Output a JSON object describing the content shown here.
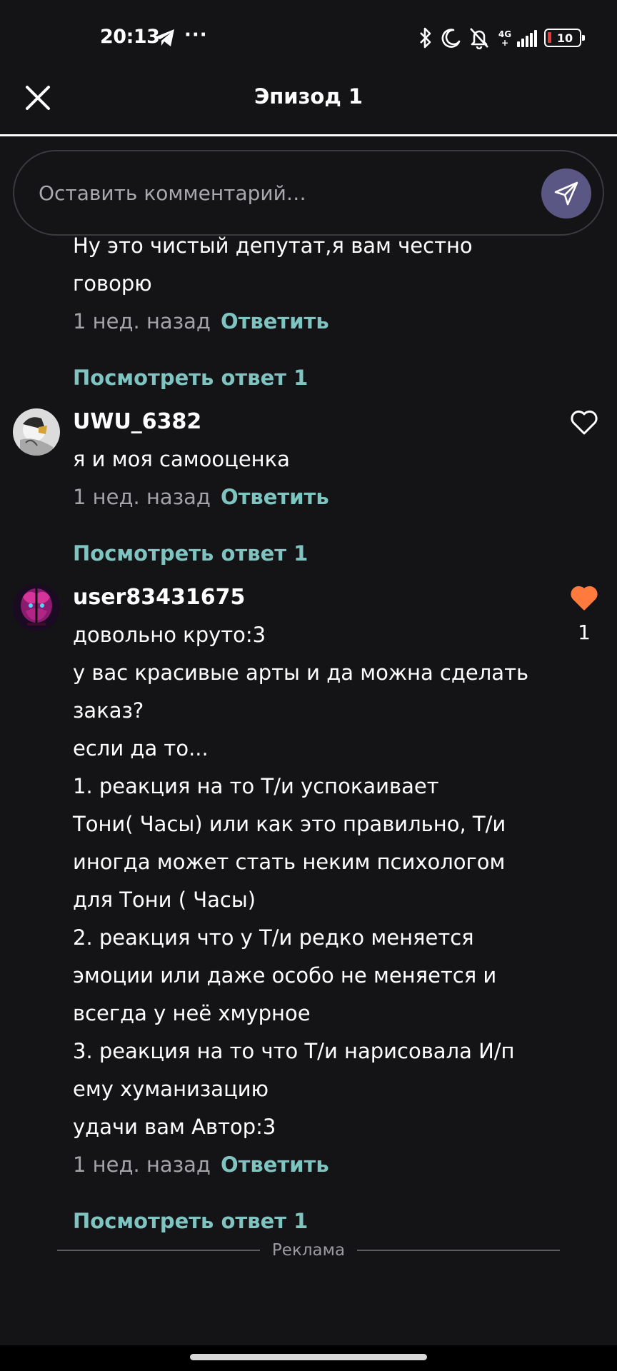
{
  "status_bar": {
    "time": "20:13",
    "dots": "···",
    "network": "4G+",
    "battery": "10"
  },
  "header": {
    "title": "Эпизод 1"
  },
  "comment_box": {
    "placeholder": "Оставить комментарий…"
  },
  "comments": [
    {
      "lines": [
        "Ну это чистый депутат,я вам честно",
        "говорю"
      ],
      "time": "1 нед. назад",
      "reply_label": "Ответить",
      "view_replies": "Посмотреть ответ 1"
    },
    {
      "username": "UWU_6382",
      "lines": [
        "я и моя самооценка"
      ],
      "time": "1 нед. назад",
      "reply_label": "Ответить",
      "view_replies": "Посмотреть ответ 1",
      "liked": false
    },
    {
      "username": "user83431675",
      "lines": [
        "довольно круто:3",
        "у вас красивые арты и да можна сделать",
        "заказ?",
        "если да то...",
        "1. реакция на то Т/и успокаивает",
        "Тони( Часы) или как это правильно, Т/и",
        "иногда может стать неким психологом",
        "для Тони ( Часы)",
        "2. реакция что у Т/и редко меняется",
        "эмоции или даже особо не меняется и",
        "всегда у неё хмурное",
        "3. реакция на то что Т/и нарисовала И/п",
        "ему хуманизацию",
        "удачи вам Автор:3"
      ],
      "time": "1 нед. назад",
      "reply_label": "Ответить",
      "view_replies": "Посмотреть ответ 1",
      "liked": true,
      "like_count": "1"
    }
  ],
  "ad": {
    "label": "Реклама"
  },
  "colors": {
    "background": "#141316",
    "accent_teal": "#7fc4c0",
    "like_active": "#ff7a3c",
    "send_button": "#5b5785"
  },
  "icons": {
    "close": "close-icon",
    "send": "send-icon",
    "heart_outline": "heart-outline-icon",
    "heart_filled": "heart-filled-icon"
  }
}
